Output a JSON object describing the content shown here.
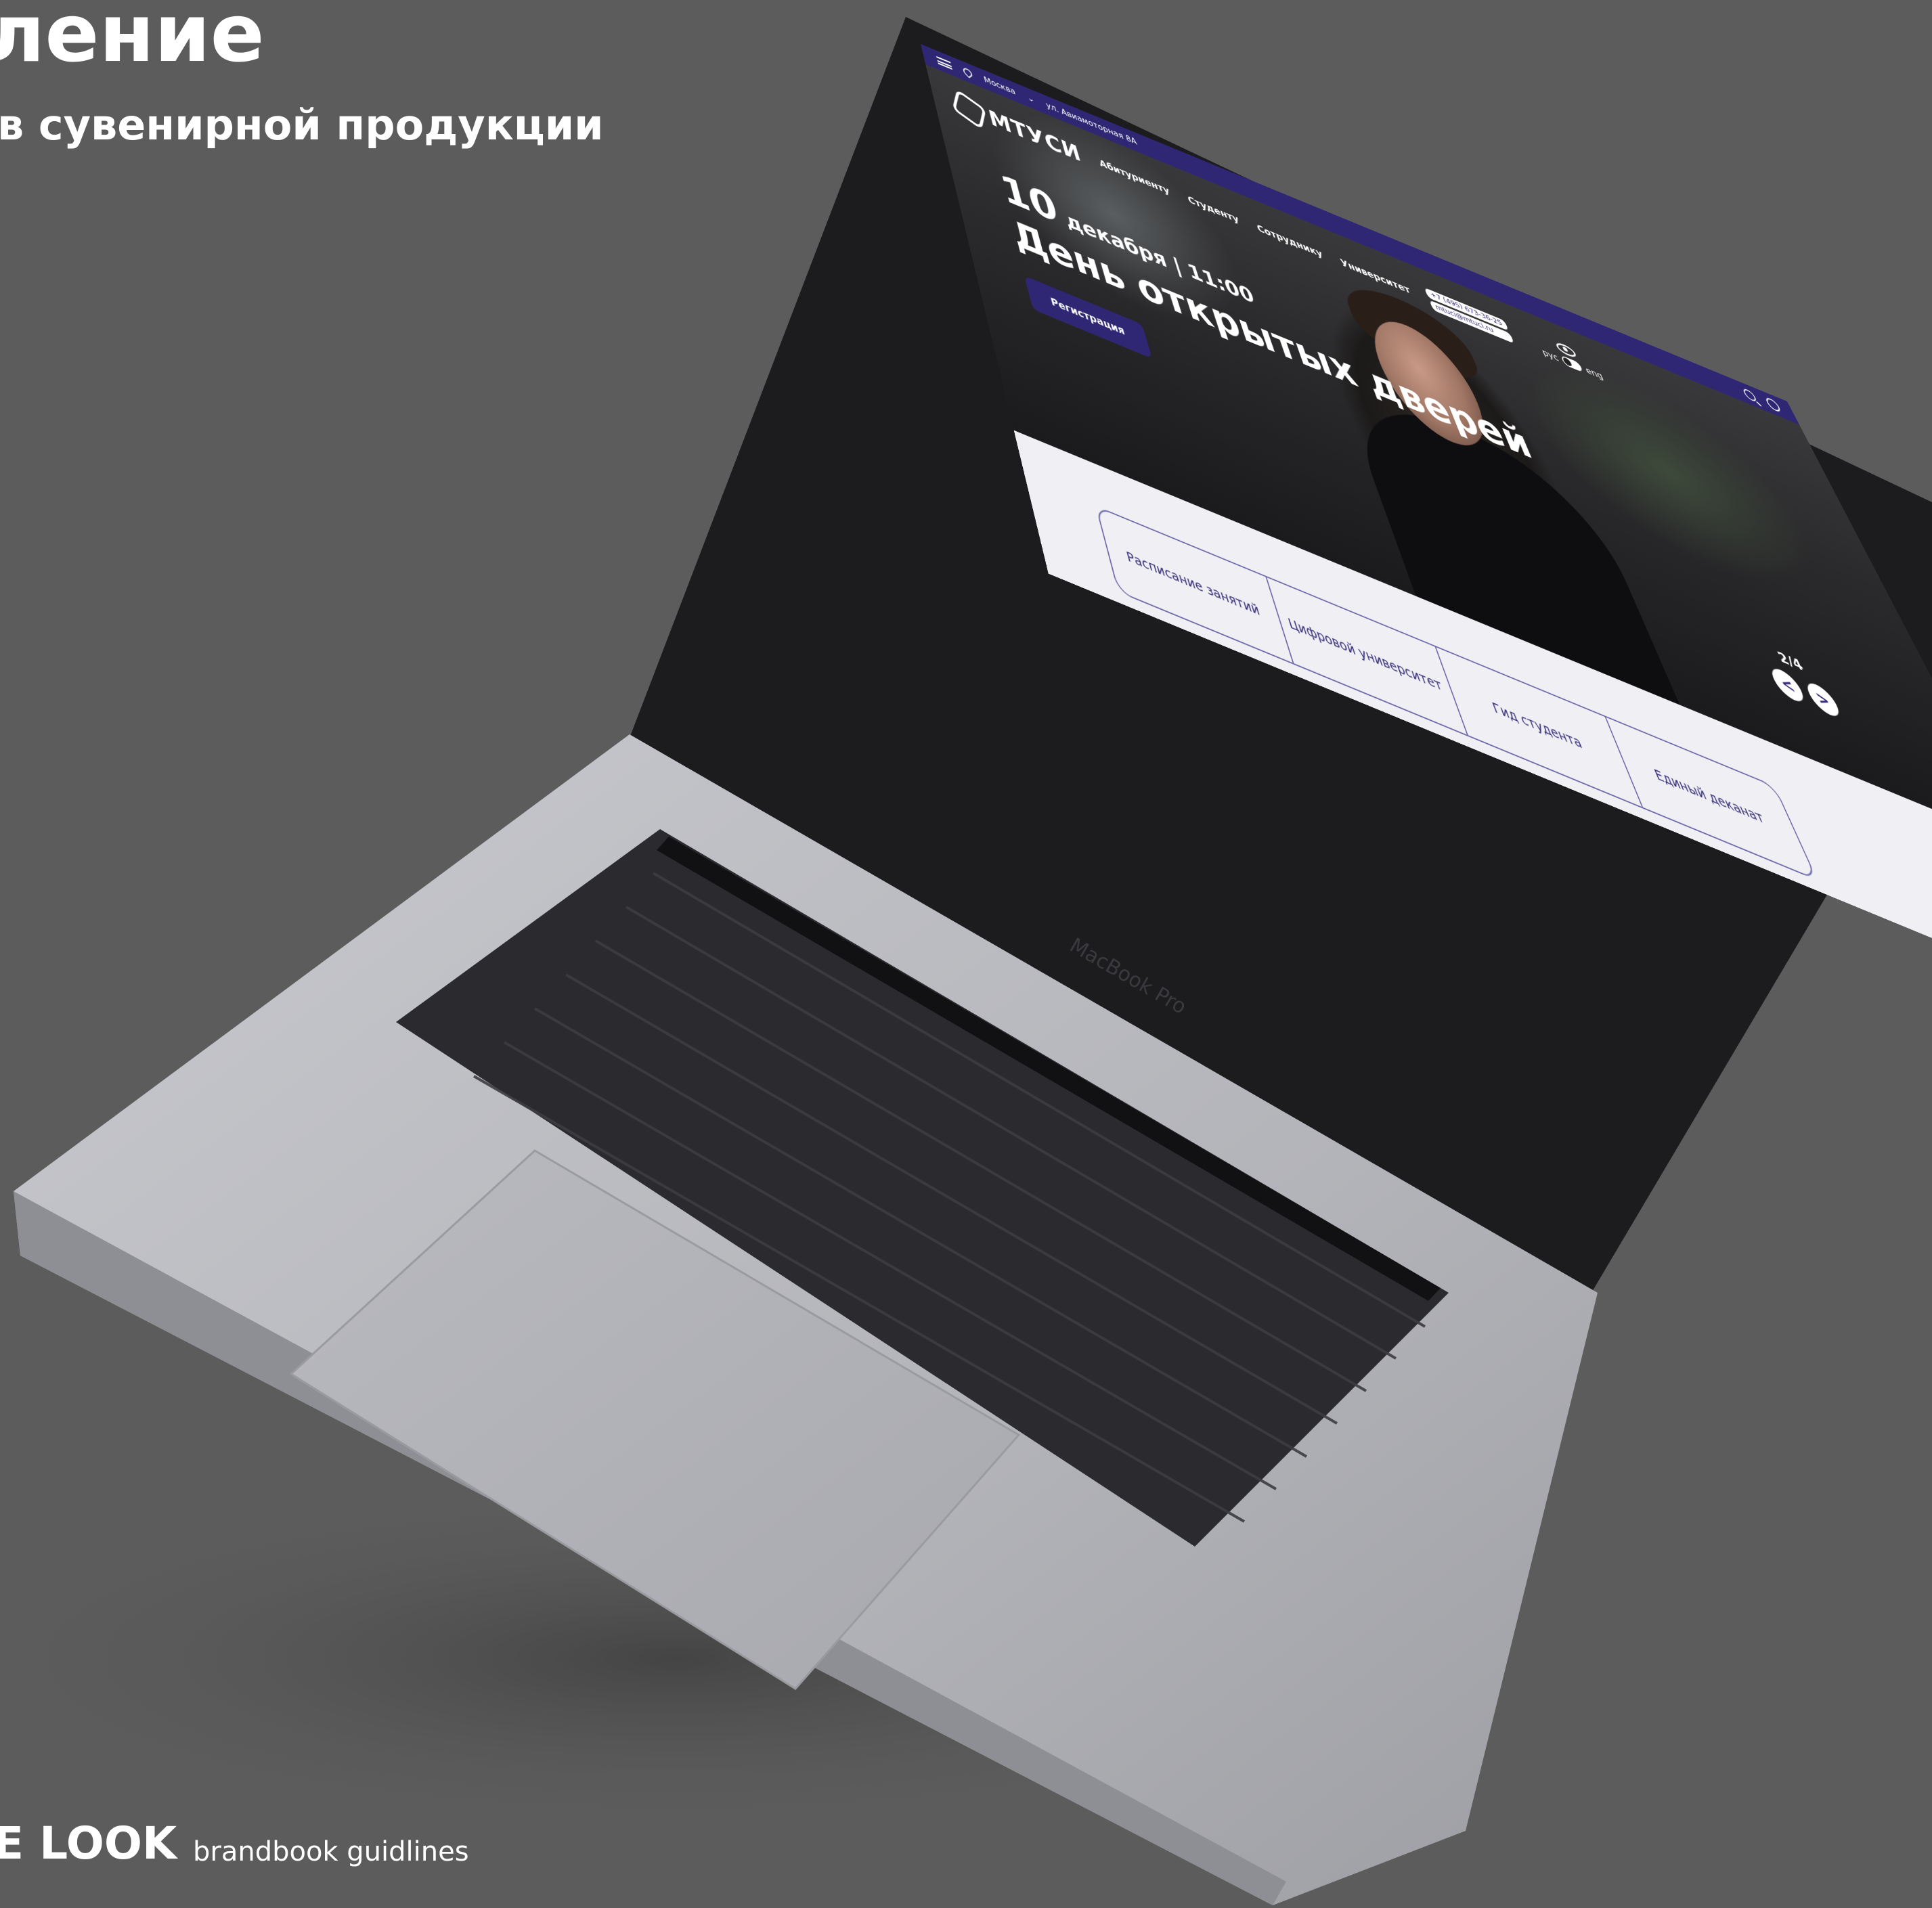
{
  "slide": {
    "heading": "ление",
    "subheading": "в сувенирной продукции",
    "brand": "E LOOK",
    "brand_sub": "brandbook guidlines"
  },
  "device": {
    "model_label": "MacBook Pro"
  },
  "website": {
    "topbar": {
      "city": "Москва",
      "address": "ул. Авиамоторная 8А"
    },
    "logo_text": "МТУСИ",
    "nav": [
      "Абитуриенту",
      "Студенту",
      "Сотруднику",
      "Университет"
    ],
    "contacts": {
      "phone": "+7 (495) 673-36-25",
      "email": "mtuci@mtuci.ru"
    },
    "lang": {
      "ru": "рус",
      "en": "eng"
    },
    "hero": {
      "day": "10",
      "date_rest": "декабря | 11:00",
      "title": "День открытых дверей",
      "button": "Регистрация"
    },
    "slider": {
      "counter": "2/4",
      "prev": "<",
      "next": ">"
    },
    "tiles": [
      "Расписание занятий",
      "Цифровой университет",
      "Гид студента",
      "Единый деканат"
    ]
  },
  "colors": {
    "background": "#5c5c5c",
    "brand_purple": "#2f2774",
    "laptop_silver": "#b8b9be"
  }
}
